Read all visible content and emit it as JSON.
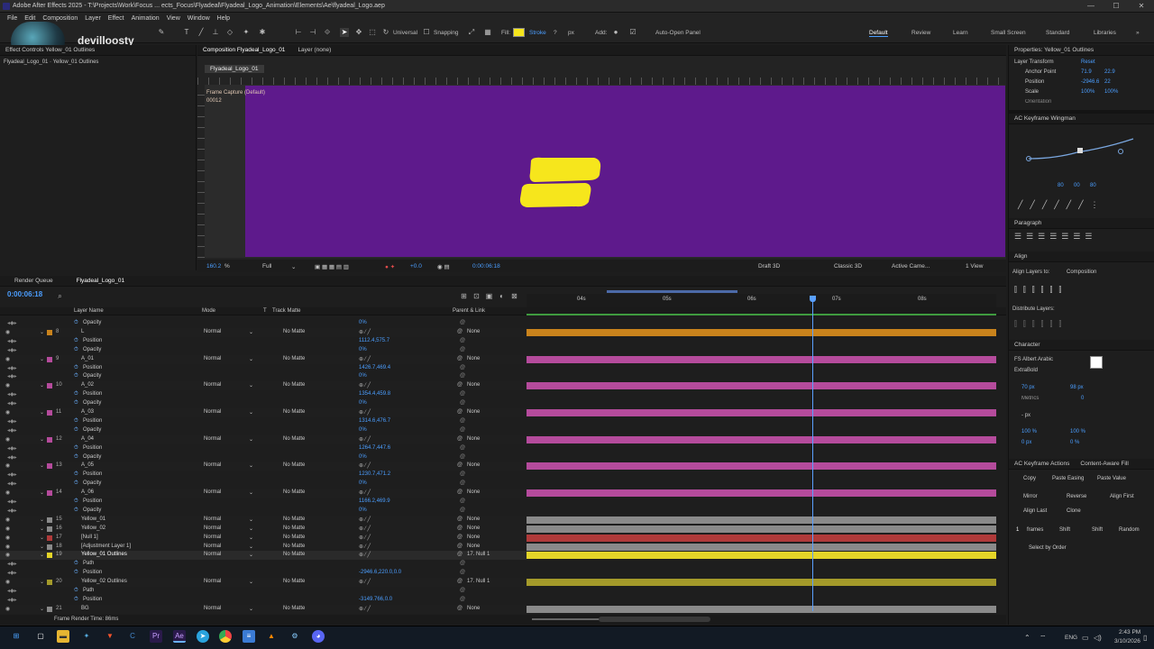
{
  "app": {
    "title": "Adobe After Effects 2025 - T:\\Projects\\Work\\Focus ... ects_Focus\\Flyadeal\\Flyadeal_Logo_Animation\\Elements\\Ae\\flyadeal_Logo.aep",
    "user": "devilloosty"
  },
  "menu": [
    "File",
    "Edit",
    "Composition",
    "Layer",
    "Effect",
    "Animation",
    "View",
    "Window",
    "Help"
  ],
  "toolbar": {
    "universal": "Universal",
    "snapping": "Snapping",
    "fill": "Fill:",
    "stroke": "Stroke",
    "stroke_q": "?",
    "px": "px",
    "add": "Add:",
    "auto_open": "Auto-Open Panel"
  },
  "workspaces": [
    "Default",
    "Review",
    "Learn",
    "Small Screen",
    "Standard",
    "Libraries"
  ],
  "project": {
    "tab": "Effect Controls Yellow_01 Outlines",
    "subtitle": "Flyadeal_Logo_01 · Yellow_01 Outlines"
  },
  "comp": {
    "tab": "Composition Flyadeal_Logo_01",
    "layer_tab": "Layer (none)",
    "crumb": "Flyadeal_Logo_01",
    "overlay": "Frame Capture (Default)",
    "overlay2": "00012",
    "zoom": "160.2",
    "quality": "Full",
    "exposure": "+0.0",
    "time": "0:00:06:18",
    "draft": "Draft 3D",
    "renderer": "Classic 3D",
    "camera": "Active Came...",
    "views": "1 View",
    "bg_color": "#5e1a8c",
    "logo_color": "#f6e61c"
  },
  "timeline": {
    "tab_render": "Render Queue",
    "tab_comp": "Flyadeal_Logo_01",
    "timecode": "0:00:06:18",
    "col_layer": "Layer Name",
    "col_mode": "Mode",
    "col_t": "T",
    "col_matte": "Track Matte",
    "col_parent": "Parent & Link",
    "ruler": [
      "04s",
      "05s",
      "06s",
      "07s",
      "08s"
    ],
    "footer": "Frame Render Time: 86ms",
    "rows": [
      {
        "name": "Opacity",
        "kind": "prop",
        "val": "0%",
        "num": "",
        "color": ""
      },
      {
        "name": "L",
        "kind": "layer",
        "num": "8",
        "mode": "Normal",
        "matte": "No Matte",
        "parent": "None",
        "color": "#c9831c"
      },
      {
        "name": "Position",
        "kind": "prop",
        "val": "1112.4,575.7",
        "num": "",
        "color": ""
      },
      {
        "name": "Opacity",
        "kind": "prop",
        "val": "0%",
        "num": "",
        "color": ""
      },
      {
        "name": "A_01",
        "kind": "layer",
        "num": "9",
        "mode": "Normal",
        "matte": "No Matte",
        "parent": "None",
        "color": "#b54b9c"
      },
      {
        "name": "Position",
        "kind": "prop",
        "val": "1426.7,469.4",
        "num": "",
        "color": ""
      },
      {
        "name": "Opacity",
        "kind": "prop",
        "val": "0%",
        "num": "",
        "color": ""
      },
      {
        "name": "A_02",
        "kind": "layer",
        "num": "10",
        "mode": "Normal",
        "matte": "No Matte",
        "parent": "None",
        "color": "#b54b9c"
      },
      {
        "name": "Position",
        "kind": "prop",
        "val": "1354.4,459.8",
        "num": "",
        "color": ""
      },
      {
        "name": "Opacity",
        "kind": "prop",
        "val": "0%",
        "num": "",
        "color": ""
      },
      {
        "name": "A_03",
        "kind": "layer",
        "num": "11",
        "mode": "Normal",
        "matte": "No Matte",
        "parent": "None",
        "color": "#b54b9c"
      },
      {
        "name": "Position",
        "kind": "prop",
        "val": "1314.6,476.7",
        "num": "",
        "color": ""
      },
      {
        "name": "Opacity",
        "kind": "prop",
        "val": "0%",
        "num": "",
        "color": ""
      },
      {
        "name": "A_04",
        "kind": "layer",
        "num": "12",
        "mode": "Normal",
        "matte": "No Matte",
        "parent": "None",
        "color": "#b54b9c"
      },
      {
        "name": "Position",
        "kind": "prop",
        "val": "1264.7,447.6",
        "num": "",
        "color": ""
      },
      {
        "name": "Opacity",
        "kind": "prop",
        "val": "0%",
        "num": "",
        "color": ""
      },
      {
        "name": "A_05",
        "kind": "layer",
        "num": "13",
        "mode": "Normal",
        "matte": "No Matte",
        "parent": "None",
        "color": "#b54b9c"
      },
      {
        "name": "Position",
        "kind": "prop",
        "val": "1230.7,471.2",
        "num": "",
        "color": ""
      },
      {
        "name": "Opacity",
        "kind": "prop",
        "val": "0%",
        "num": "",
        "color": ""
      },
      {
        "name": "A_06",
        "kind": "layer",
        "num": "14",
        "mode": "Normal",
        "matte": "No Matte",
        "parent": "None",
        "color": "#b54b9c"
      },
      {
        "name": "Position",
        "kind": "prop",
        "val": "1166.2,469.9",
        "num": "",
        "color": ""
      },
      {
        "name": "Opacity",
        "kind": "prop",
        "val": "0%",
        "num": "",
        "color": ""
      },
      {
        "name": "Yellow_01",
        "kind": "layer",
        "num": "15",
        "mode": "Normal",
        "matte": "No Matte",
        "parent": "None",
        "color": "#8a8a8a"
      },
      {
        "name": "Yellow_02",
        "kind": "layer",
        "num": "16",
        "mode": "Normal",
        "matte": "No Matte",
        "parent": "None",
        "color": "#8a8a8a"
      },
      {
        "name": "[Null 1]",
        "kind": "layer",
        "num": "17",
        "mode": "Normal",
        "matte": "No Matte",
        "parent": "None",
        "color": "#b03a3a"
      },
      {
        "name": "[Adjustment Layer 1]",
        "kind": "layer",
        "num": "18",
        "mode": "Normal",
        "matte": "No Matte",
        "parent": "None",
        "color": "#8a8a8a"
      },
      {
        "name": "Yellow_01 Outlines",
        "kind": "layer",
        "num": "19",
        "mode": "Normal",
        "matte": "No Matte",
        "parent": "17. Null 1",
        "color": "#e5d528"
      },
      {
        "name": "Path",
        "kind": "prop",
        "val": "",
        "num": "",
        "color": ""
      },
      {
        "name": "Position",
        "kind": "prop",
        "val": "-2946.6,220.0,0.0",
        "num": "",
        "color": ""
      },
      {
        "name": "Yellow_02 Outlines",
        "kind": "layer",
        "num": "20",
        "mode": "Normal",
        "matte": "No Matte",
        "parent": "17. Null 1",
        "color": "#a49a2a"
      },
      {
        "name": "Path",
        "kind": "prop",
        "val": "",
        "num": "",
        "color": ""
      },
      {
        "name": "Position",
        "kind": "prop",
        "val": "-3149.766,0.0",
        "num": "",
        "color": ""
      },
      {
        "name": "BG",
        "kind": "layer",
        "num": "21",
        "mode": "Normal",
        "matte": "No Matte",
        "parent": "None",
        "color": "#8a8a8a"
      }
    ]
  },
  "right": {
    "props_title": "Properties: Yellow_01 Outlines",
    "layer_transform": "Layer Transform",
    "reset": "Reset",
    "anchor": "Anchor Point",
    "anchor_v": [
      "71.9",
      "22.9"
    ],
    "position": "Position",
    "position_v": [
      "-2946.6",
      "22"
    ],
    "scale": "Scale",
    "scale_v": [
      "100%",
      "100%"
    ],
    "orientation": "Orientation",
    "wingman": "AC Keyframe Wingman",
    "wing_vals": [
      "80",
      "00",
      "80"
    ],
    "paragraph": "Paragraph",
    "align": "Align",
    "align_to": "Align Layers to:",
    "align_target": "Composition",
    "distribute": "Distribute Layers:",
    "character": "Character",
    "font": "FS Albert Arabic",
    "style": "ExtraBold",
    "size": "70 px",
    "leading": "98 px",
    "tracking": "0",
    "kern": "Metrics",
    "unit": "- px",
    "vscale": "100 %",
    "hscale": "100 %",
    "baseline": "0 px",
    "tsume": "0 %",
    "kf_actions": "AC Keyframe Actions",
    "content_fill": "Content-Aware Fill",
    "kfa_row1": [
      "Copy",
      "Paste Easing",
      "Paste Value"
    ],
    "kfa_row2": [
      "Mirror",
      "Reverse",
      "Align First"
    ],
    "kfa_row3": [
      "Align Last",
      "Clone"
    ],
    "kfa_row4": [
      "1",
      "frames",
      "Shift",
      "Shift",
      "Random"
    ],
    "kfa_row5": "Select by Order"
  },
  "taskbar": {
    "lang": "ENG",
    "time": "2:43 PM",
    "date": "3/10/2026"
  }
}
